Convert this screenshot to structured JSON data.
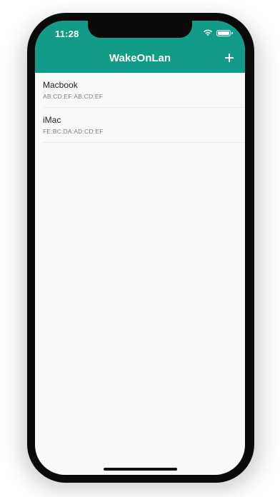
{
  "status_bar": {
    "time": "11:28"
  },
  "app_bar": {
    "title": "WakeOnLan",
    "add_label": "+"
  },
  "devices": [
    {
      "name": "Macbook",
      "mac": "AB:CD:EF:AB:CD:EF"
    },
    {
      "name": "iMac",
      "mac": "FE:BC:DA:AD:CD:EF"
    }
  ],
  "colors": {
    "accent": "#129b89",
    "background": "#fafafa",
    "bezel": "#0a0a0a"
  },
  "icons": [
    "wifi-icon",
    "battery-icon",
    "plus-icon",
    "signal-icon"
  ]
}
